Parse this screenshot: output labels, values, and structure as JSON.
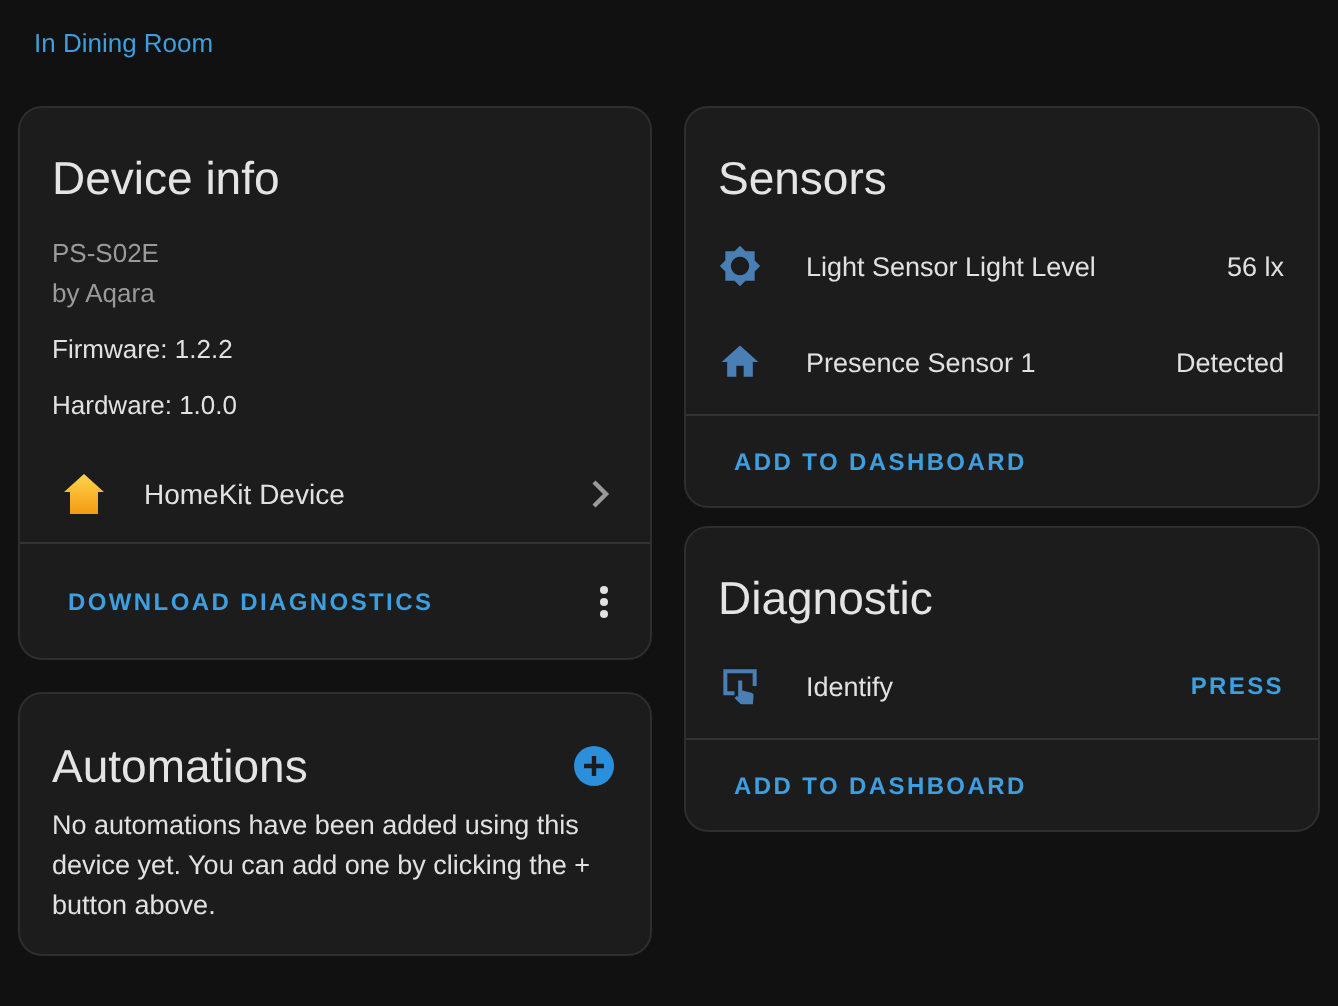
{
  "area_link": "In Dining Room",
  "device_info": {
    "title": "Device info",
    "model": "PS-S02E",
    "manufacturer": "by Aqara",
    "firmware": "Firmware: 1.2.2",
    "hardware": "Hardware: 1.0.0",
    "integration": "HomeKit Device",
    "action": "DOWNLOAD DIAGNOSTICS"
  },
  "automations": {
    "title": "Automations",
    "message": "No automations have been added using this device yet. You can add one by clicking the + button above."
  },
  "sensors": {
    "title": "Sensors",
    "entities": [
      {
        "kind": "state",
        "name": "Light Sensor Light Level",
        "value": "56 lx"
      },
      {
        "kind": "state",
        "name": "Presence Sensor 1",
        "value": "Detected"
      }
    ],
    "action": "ADD TO DASHBOARD"
  },
  "diagnostic": {
    "title": "Diagnostic",
    "entities": [
      {
        "kind": "button",
        "name": "Identify",
        "value": "PRESS"
      }
    ],
    "action": "ADD TO DASHBOARD"
  }
}
